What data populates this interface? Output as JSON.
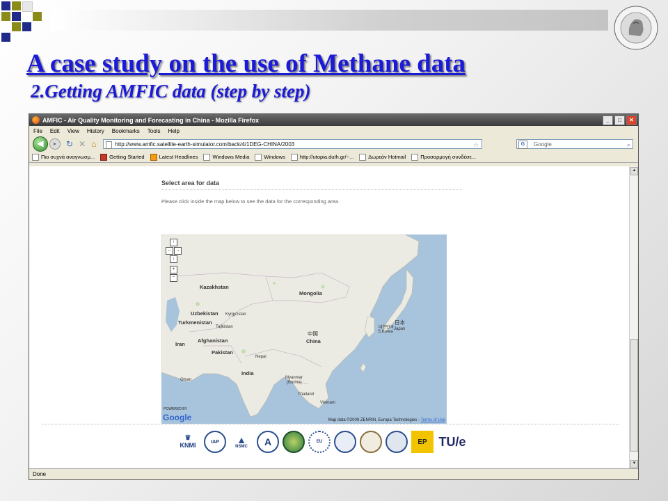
{
  "slide": {
    "title": "A case study on the use of Methane data",
    "subtitle": "2.Getting AMFIC data (step by step)",
    "colors": {
      "title": "#1a1ad8",
      "deco_blue": "#1f2a8a",
      "deco_olive": "#8b8b1a"
    }
  },
  "browser": {
    "window_title": "AMFIC - Air Quality Monitoring and Forecasting in China - Mozilla Firefox",
    "window_buttons": {
      "minimize": "_",
      "maximize": "□",
      "close": "✕"
    },
    "menu": [
      "File",
      "Edit",
      "View",
      "History",
      "Bookmarks",
      "Tools",
      "Help"
    ],
    "nav": {
      "back": "◀",
      "forward": "▸",
      "reload": "↻",
      "stop": "✕",
      "home": "⌂"
    },
    "url": "http://www.amfic.satellite-earth-simulator.com/back/4/1DEG-CHINA/2003",
    "search_placeholder": "Google",
    "search_engine_glyph": "G",
    "bookmarks": [
      "Πιο συχνά αναγνωσμ...",
      "Getting Started",
      "Latest Headlines",
      "Windows Media",
      "Windows",
      "http://utopia.duth.gr/~...",
      "Δωρεάν Hotmail",
      "Προσαρμογή συνδέσε..."
    ],
    "status": "Done"
  },
  "page": {
    "section_title": "Select area for data",
    "instruction": "Please click inside the map below to see the data for the corresponding area.",
    "map": {
      "controls": [
        "↑",
        "←",
        "→",
        "↓",
        "+",
        "−"
      ],
      "labels": {
        "kazakhstan": "Kazakhstan",
        "mongolia": "Mongolia",
        "uzbekistan": "Uzbekistan",
        "kyrgyzstan": "Kyrgyzstan",
        "turkmenistan": "Turkmenistan",
        "tajikistan": "Tajikistan",
        "afghanistan": "Afghanistan",
        "iran": "Iran",
        "pakistan": "Pakistan",
        "nepal": "Nepal",
        "india": "India",
        "china_cn": "中国",
        "china": "China",
        "korea_kr": "대한민국",
        "s_korea": "S.Korea",
        "japan_jp": "日本",
        "japan": "Japan",
        "myanmar": "Myanmar",
        "burma": "(Burma)",
        "thailand": "Thailand",
        "vietnam": "Vietnam",
        "oman": "Oman"
      },
      "powered_by": "POWERED BY",
      "google_logo": "Google",
      "copyright": "Map data ©2009 ZENRIN, Europa Technologies -",
      "terms_link": "Terms of Use"
    },
    "partner_logos": [
      "KNMI",
      "IAP",
      "NSMC",
      "A",
      "globe",
      "EU",
      "seal-1",
      "seal-2",
      "tri",
      "EP",
      "TU/e"
    ]
  }
}
